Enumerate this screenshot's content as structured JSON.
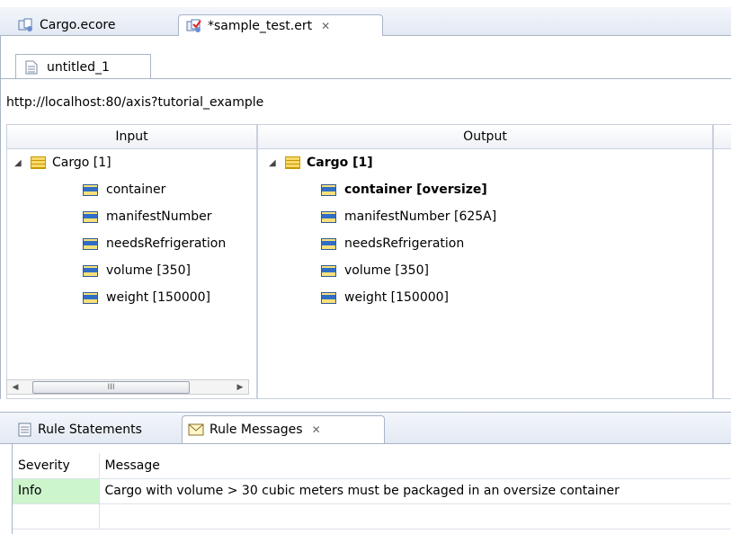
{
  "editor_tabs": [
    {
      "label": "Cargo.ecore",
      "icon": "ecore-file-icon"
    },
    {
      "label": "*sample_test.ert",
      "icon": "rule-test-file-icon",
      "close_glyph": "✕"
    }
  ],
  "sub_tab": {
    "label": "untitled_1"
  },
  "url": "http://localhost:80/axis?tutorial_example",
  "grid": {
    "headers": [
      "Input",
      "Output"
    ],
    "input_tree": {
      "root": "Cargo [1]",
      "children": [
        "container",
        "manifestNumber",
        "needsRefrigeration",
        "volume [350]",
        "weight [150000]"
      ]
    },
    "output_tree": {
      "root": "Cargo [1]",
      "children": [
        "container [oversize]",
        "manifestNumber [625A]",
        "needsRefrigeration",
        "volume [350]",
        "weight [150000]"
      ]
    },
    "scrollbar": {
      "left_arrow": "◀",
      "right_arrow": "▶",
      "grip": "III"
    }
  },
  "view_tabs": [
    {
      "label": "Rule Statements",
      "icon": "rule-statements-icon"
    },
    {
      "label": "Rule Messages",
      "icon": "envelope-icon",
      "close_glyph": "✕"
    }
  ],
  "messages": {
    "columns": [
      "Severity",
      "Message"
    ],
    "rows": [
      {
        "severity": "Info",
        "message": "Cargo with volume > 30 cubic meters must be packaged in an oversize container"
      }
    ]
  },
  "colors": {
    "info_bg": "#ccf5cc",
    "border": "#a8b4c6"
  }
}
